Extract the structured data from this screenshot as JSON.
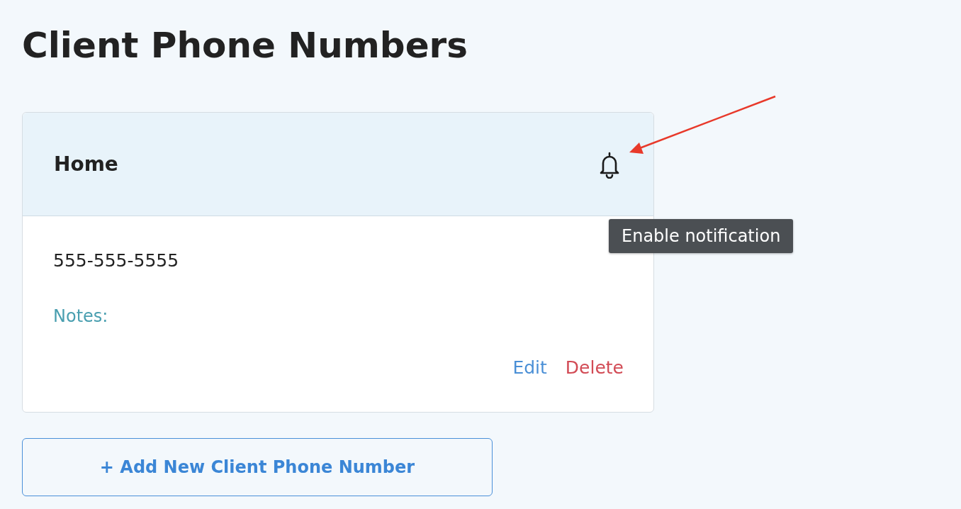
{
  "page": {
    "title": "Client Phone Numbers"
  },
  "cards": [
    {
      "label": "Home",
      "phone": "555-555-5555",
      "notes_label": "Notes:",
      "actions": [
        {
          "label": "Edit",
          "kind": "edit"
        },
        {
          "label": "Delete",
          "kind": "delete"
        }
      ]
    }
  ],
  "tooltip": {
    "text": "Enable notification"
  },
  "add_button": {
    "label": "+ Add New Client Phone Number"
  }
}
